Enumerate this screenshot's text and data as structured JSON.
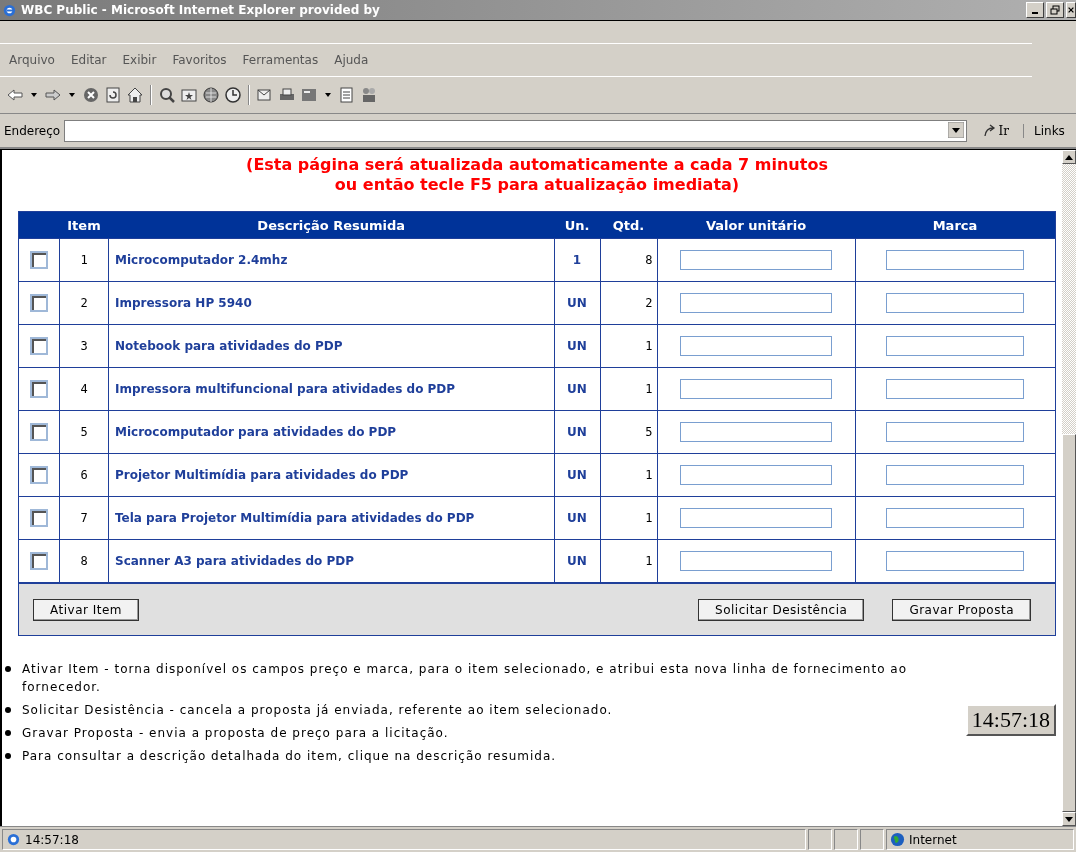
{
  "window": {
    "title": "WBC Public - Microsoft Internet Explorer provided by"
  },
  "menu": [
    "Arquivo",
    "Editar",
    "Exibir",
    "Favoritos",
    "Ferramentas",
    "Ajuda"
  ],
  "address_bar": {
    "label": "Endereço",
    "go": "Ir",
    "links": "Links"
  },
  "notice": [
    "(Esta página será atualizada automaticamente a cada 7 minutos",
    "ou então tecle F5 para atualização imediata)"
  ],
  "table": {
    "columns": [
      "Item",
      "Descrição Resumida",
      "Un.",
      "Qtd.",
      "Valor unitário",
      "Marca"
    ],
    "rows": [
      {
        "checked": false,
        "item": "1",
        "description": "Microcomputador 2.4mhz",
        "unit": "1",
        "qty": "8"
      },
      {
        "checked": false,
        "item": "2",
        "description": "Impressora HP 5940",
        "unit": "UN",
        "qty": "2"
      },
      {
        "checked": false,
        "item": "3",
        "description": "Notebook para atividades do PDP",
        "unit": "UN",
        "qty": "1"
      },
      {
        "checked": false,
        "item": "4",
        "description": "Impressora multifuncional para atividades do PDP",
        "unit": "UN",
        "qty": "1"
      },
      {
        "checked": false,
        "item": "5",
        "description": "Microcomputador para atividades do PDP",
        "unit": "UN",
        "qty": "5"
      },
      {
        "checked": false,
        "item": "6",
        "description": "Projetor Multimídia para atividades do PDP",
        "unit": "UN",
        "qty": "1"
      },
      {
        "checked": false,
        "item": "7",
        "description": "Tela para Projetor Multimídia para atividades do PDP",
        "unit": "UN",
        "qty": "1"
      },
      {
        "checked": false,
        "item": "8",
        "description": "Scanner A3 para atividades do PDP",
        "unit": "UN",
        "qty": "1"
      }
    ]
  },
  "buttons": [
    "Ativar Item",
    "Solicitar Desistência",
    "Gravar Proposta"
  ],
  "notes": [
    "Ativar Item - torna disponível os campos preço e marca, para o item selecionado, e atribui esta nova linha de fornecimento ao fornecedor.",
    "Solicitar Desistência - cancela a proposta já enviada, referente ao item selecionado.",
    "Gravar Proposta - envia a proposta de preço para a licitação.",
    "Para consultar a descrição detalhada do item, clique na descrição resumida."
  ],
  "clock": "14:57:18",
  "status_bar": {
    "text": "14:57:18",
    "zone": "Internet"
  }
}
